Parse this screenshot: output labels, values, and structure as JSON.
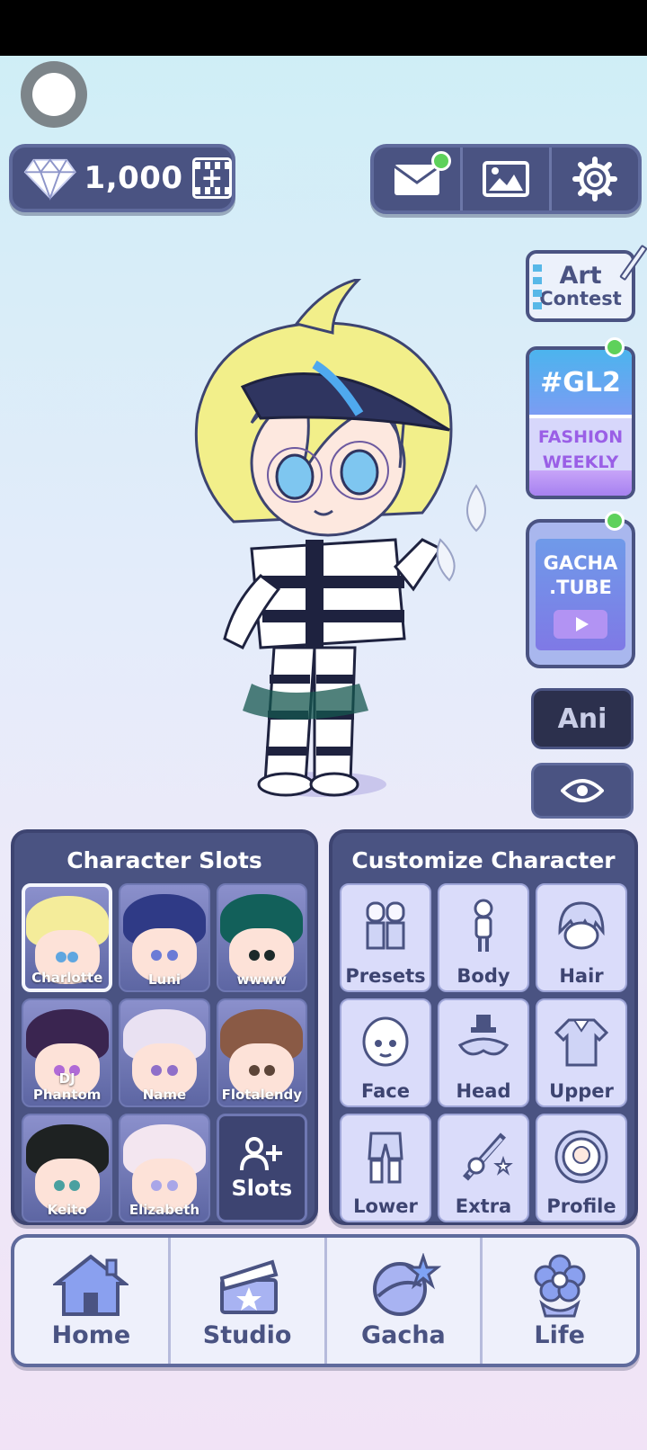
{
  "currency": {
    "gems": "1,000"
  },
  "side_buttons": {
    "art_contest_line1": "Art",
    "art_contest_line2": "Contest",
    "gl2_tag": "#GL2",
    "gl2_line1": "FASHION",
    "gl2_line2": "WEEKLY",
    "gacha_tube_line1": "GACHA",
    "gacha_tube_line2": ".TUBE",
    "ani_label": "Ani"
  },
  "character_slots": {
    "title": "Character Slots",
    "slots": [
      {
        "name": "Charlotte",
        "hair": "#f4ec9a",
        "eye": "#5fa6e0",
        "selected": true
      },
      {
        "name": "Luni",
        "hair": "#2f3a86",
        "eye": "#6b7bd6"
      },
      {
        "name": "wwww",
        "hair": "#12605a",
        "eye": "#1c2a2a"
      },
      {
        "name": "DJ Phantom",
        "hair": "#3a2550",
        "eye": "#b06ad6"
      },
      {
        "name": "Name",
        "hair": "#e9e1f2",
        "eye": "#8f6fc9"
      },
      {
        "name": "Flotalendy",
        "hair": "#8a5a45",
        "eye": "#5d4538"
      },
      {
        "name": "Keito",
        "hair": "#1e2222",
        "eye": "#4aa0a0"
      },
      {
        "name": "Elizabeth",
        "hair": "#f3e6f0",
        "eye": "#a9a6e8"
      }
    ],
    "add_label": "Slots"
  },
  "customize": {
    "title": "Customize Character",
    "items": [
      "Presets",
      "Body",
      "Hair",
      "Face",
      "Head",
      "Upper",
      "Lower",
      "Extra",
      "Profile"
    ]
  },
  "nav": {
    "home": "Home",
    "studio": "Studio",
    "gacha": "Gacha",
    "life": "Life"
  },
  "colors": {
    "panel": "#4a5382",
    "accent_green": "#5ed15b",
    "tile": "#dadcfa"
  }
}
